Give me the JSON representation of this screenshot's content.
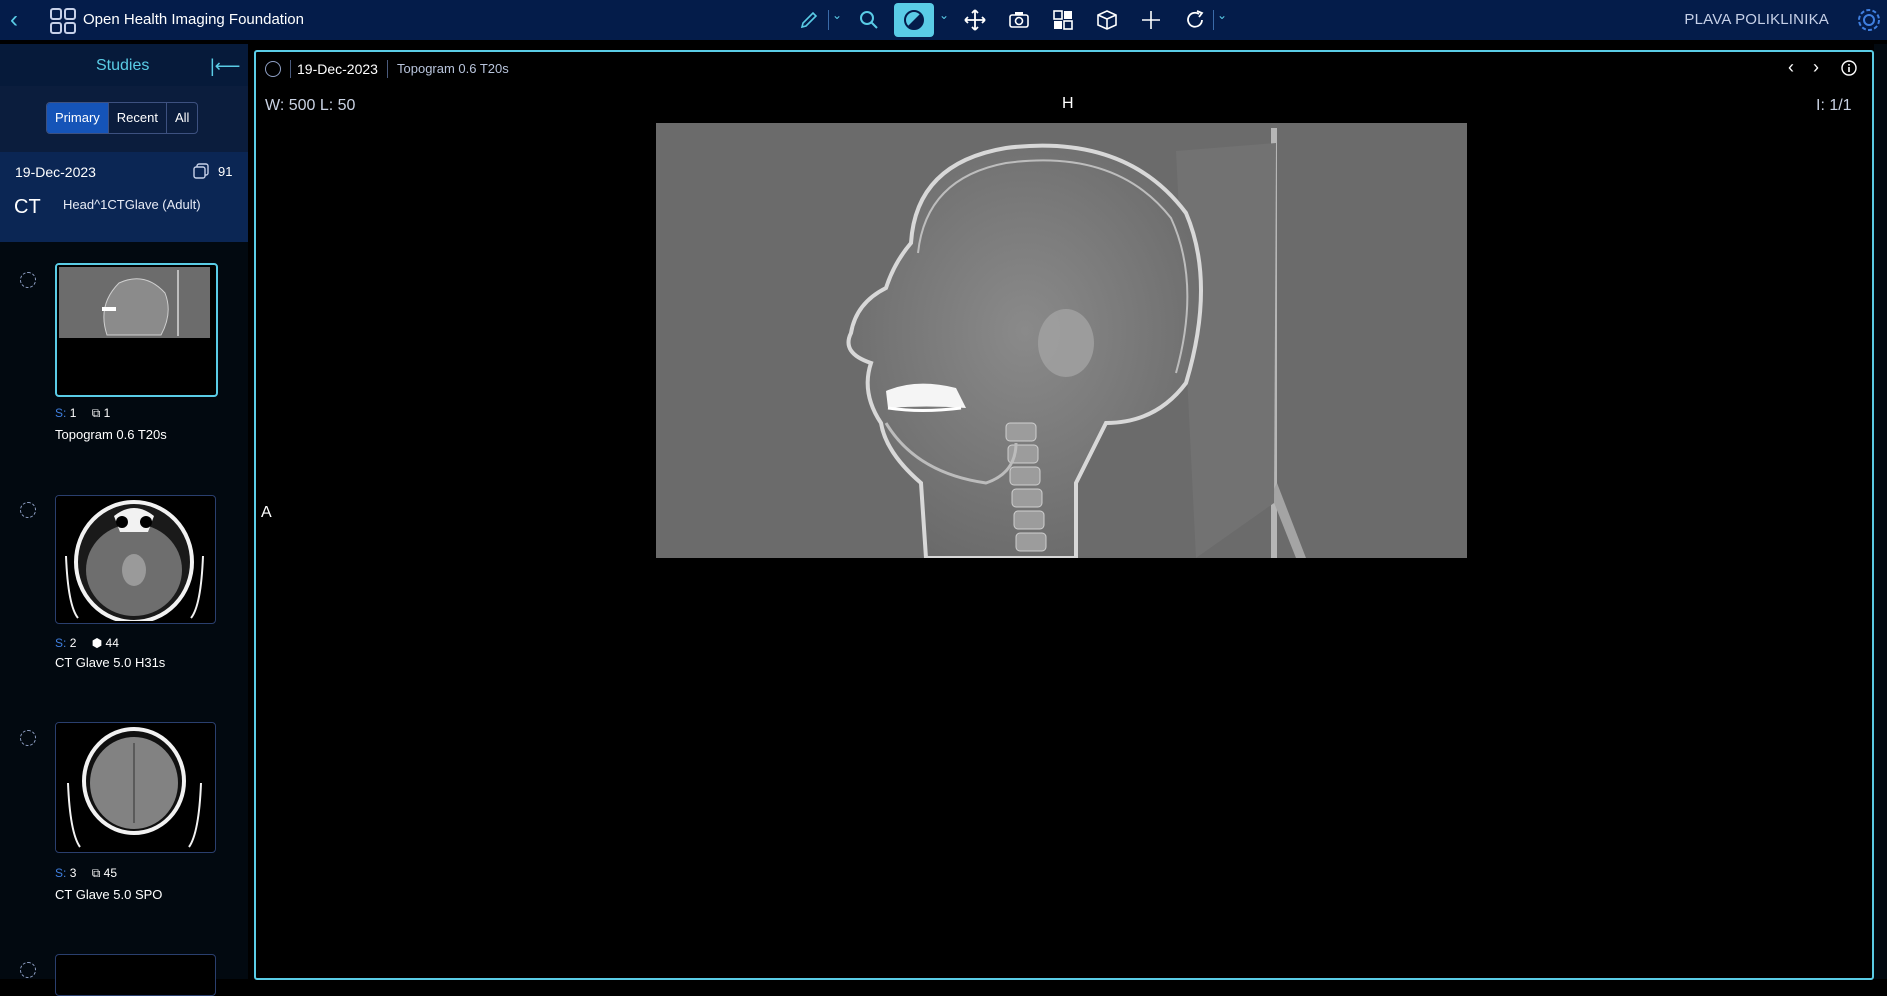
{
  "header": {
    "brand": "Open Health Imaging Foundation",
    "org": "PLAVA POLIKLINIKA",
    "tools": [
      "pencil-icon",
      "zoom-icon",
      "contrast-icon",
      "pan-icon",
      "camera-icon",
      "layout-icon",
      "cube-icon",
      "crosshair-icon",
      "rotate-icon"
    ]
  },
  "sidebar": {
    "title": "Studies",
    "tabs": [
      "Primary",
      "Recent",
      "All"
    ],
    "active_tab": "Primary",
    "study": {
      "date": "19-Dec-2023",
      "count": "91",
      "modality": "CT",
      "description": "Head^1CTGlave (Adult)"
    },
    "series": [
      {
        "s_label": "S:",
        "num": "1",
        "count": "1",
        "name": "Topogram 0.6 T20s"
      },
      {
        "s_label": "S:",
        "num": "2",
        "count": "44",
        "name": "CT Glave 5.0 H31s"
      },
      {
        "s_label": "S:",
        "num": "3",
        "count": "45",
        "name": "CT Glave 5.0 SPO"
      }
    ]
  },
  "viewport": {
    "date": "19-Dec-2023",
    "series": "Topogram 0.6 T20s",
    "wl": "W: 500  L: 50",
    "orientation_top": "H",
    "orientation_left": "A",
    "index": "I: 1/1"
  },
  "colors": {
    "accent": "#5acce6",
    "topbar": "#041c4a",
    "sidebar": "#020910"
  }
}
